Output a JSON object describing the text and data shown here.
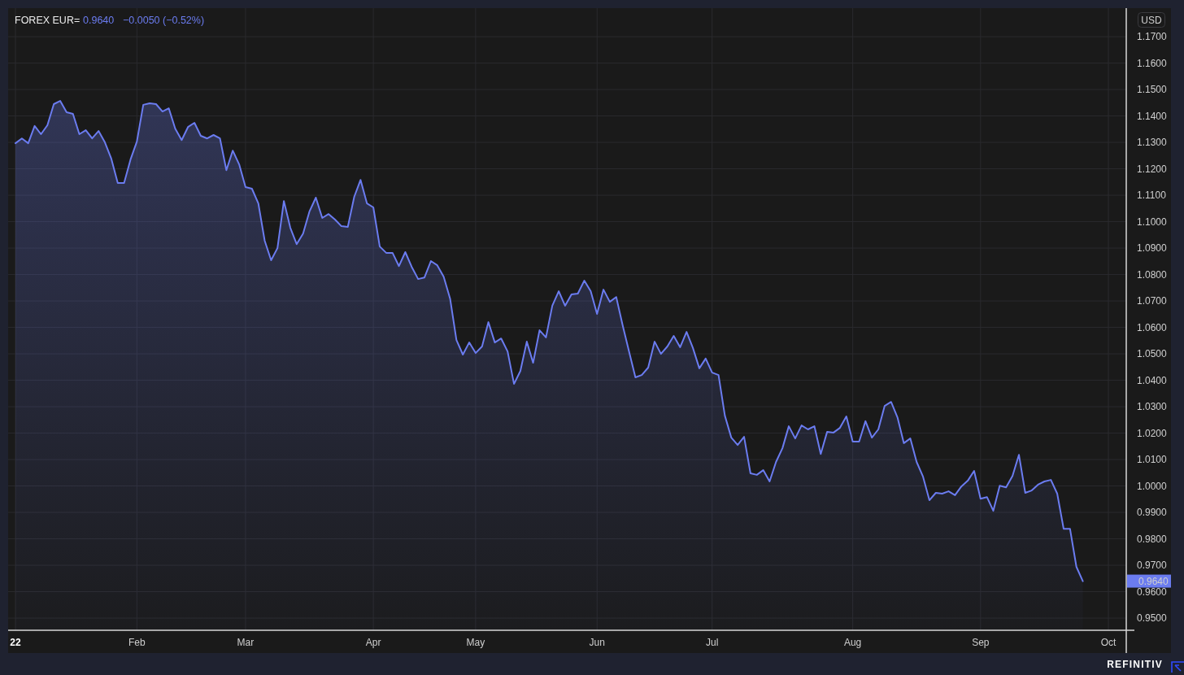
{
  "legend": {
    "last": "0.9640",
    "change": "−0.0050 (−0.52%)"
  },
  "currency": "USD",
  "price_badge": "0.9640",
  "chart_data": {
    "type": "area",
    "grid": true,
    "ylim": [
      0.9454,
      1.1808
    ],
    "categories": [
      "22",
      null,
      null,
      null,
      null,
      null,
      null,
      null,
      null,
      null,
      null,
      null,
      null,
      null,
      null,
      null,
      null,
      null,
      null,
      "Feb",
      null,
      null,
      null,
      null,
      null,
      null,
      null,
      null,
      null,
      null,
      null,
      null,
      null,
      null,
      null,
      null,
      "Mar",
      null,
      null,
      null,
      null,
      null,
      null,
      null,
      null,
      null,
      null,
      null,
      null,
      null,
      null,
      null,
      null,
      null,
      null,
      null,
      "Apr",
      null,
      null,
      null,
      null,
      null,
      null,
      null,
      null,
      null,
      null,
      null,
      null,
      null,
      null,
      null,
      "May",
      null,
      null,
      null,
      null,
      null,
      null,
      null,
      null,
      null,
      null,
      null,
      null,
      null,
      null,
      null,
      null,
      null,
      null,
      "Jun",
      null,
      null,
      null,
      null,
      null,
      null,
      null,
      null,
      null,
      null,
      null,
      null,
      null,
      null,
      null,
      null,
      null,
      "Jul",
      null,
      null,
      null,
      null,
      null,
      null,
      null,
      null,
      null,
      null,
      null,
      null,
      null,
      null,
      null,
      null,
      null,
      null,
      null,
      null,
      null,
      "Aug",
      null,
      null,
      null,
      null,
      null,
      null,
      null,
      null,
      null,
      null,
      null,
      null,
      null,
      null,
      null,
      null,
      null,
      null,
      null,
      "Sep",
      null,
      null,
      null,
      null,
      null,
      null,
      null,
      null,
      null,
      null,
      null,
      null,
      null,
      null,
      null,
      null,
      null,
      null,
      null,
      "Oct"
    ],
    "yticks": [
      {
        "value": 1.17,
        "label": "1.1700"
      },
      {
        "value": 1.16,
        "label": "1.1600"
      },
      {
        "value": 1.15,
        "label": "1.1500"
      },
      {
        "value": 1.14,
        "label": "1.1400"
      },
      {
        "value": 1.13,
        "label": "1.1300"
      },
      {
        "value": 1.12,
        "label": "1.1200"
      },
      {
        "value": 1.11,
        "label": "1.1100"
      },
      {
        "value": 1.1,
        "label": "1.1000"
      },
      {
        "value": 1.09,
        "label": "1.0900"
      },
      {
        "value": 1.08,
        "label": "1.0800"
      },
      {
        "value": 1.07,
        "label": "1.0700"
      },
      {
        "value": 1.06,
        "label": "1.0600"
      },
      {
        "value": 1.05,
        "label": "1.0500"
      },
      {
        "value": 1.04,
        "label": "1.0400"
      },
      {
        "value": 1.03,
        "label": "1.0300"
      },
      {
        "value": 1.02,
        "label": "1.0200"
      },
      {
        "value": 1.01,
        "label": "1.0100"
      },
      {
        "value": 1.0,
        "label": "1.0000"
      },
      {
        "value": 0.99,
        "label": "0.9900"
      },
      {
        "value": 0.98,
        "label": "0.9800"
      },
      {
        "value": 0.97,
        "label": "0.9700"
      },
      {
        "value": 0.96,
        "label": "0.9600"
      },
      {
        "value": 0.95,
        "label": "0.9500"
      }
    ],
    "series": [
      {
        "name": "FOREX EUR=",
        "color": "#6b7cf0",
        "values": [
          1.1297,
          1.1315,
          1.1297,
          1.1362,
          1.1331,
          1.1365,
          1.1445,
          1.1457,
          1.1414,
          1.1408,
          1.1331,
          1.1346,
          1.1315,
          1.1343,
          1.13,
          1.1238,
          1.1146,
          1.1146,
          1.1235,
          1.1303,
          1.1442,
          1.1448,
          1.1445,
          1.1417,
          1.1429,
          1.1352,
          1.1309,
          1.1358,
          1.1374,
          1.1325,
          1.1315,
          1.1328,
          1.1315,
          1.1195,
          1.1269,
          1.1217,
          1.1131,
          1.1125,
          1.1069,
          1.0928,
          1.0854,
          1.09,
          1.1078,
          1.0977,
          1.0915,
          1.0955,
          1.1038,
          1.1091,
          1.1014,
          1.1029,
          1.1008,
          1.0983,
          1.098,
          1.1094,
          1.1158,
          1.1069,
          1.1054,
          1.0906,
          1.0882,
          1.0882,
          1.0832,
          1.0885,
          1.0829,
          1.0783,
          1.0789,
          1.0851,
          1.0835,
          1.0792,
          1.0709,
          1.0552,
          1.0497,
          1.0543,
          1.0503,
          1.0528,
          1.062,
          1.0543,
          1.0558,
          1.0509,
          1.0386,
          1.0435,
          1.0546,
          1.0466,
          1.0589,
          1.0562,
          1.0682,
          1.0737,
          1.0682,
          1.0725,
          1.0728,
          1.0777,
          1.0737,
          1.0651,
          1.0743,
          1.0697,
          1.0715,
          1.0608,
          1.0509,
          1.0411,
          1.042,
          1.0448,
          1.0546,
          1.05,
          1.0528,
          1.0568,
          1.0525,
          1.0583,
          1.0522,
          1.0445,
          1.0482,
          1.0429,
          1.042,
          1.0266,
          1.0183,
          1.0155,
          1.0186,
          1.0048,
          1.0042,
          1.006,
          1.0017,
          1.0091,
          1.0143,
          1.0226,
          1.018,
          1.0229,
          1.0214,
          1.0226,
          1.0121,
          1.0205,
          1.0202,
          1.022,
          1.0263,
          1.0168,
          1.0168,
          1.0245,
          1.0183,
          1.0214,
          1.0303,
          1.0318,
          1.026,
          1.0162,
          1.018,
          1.0091,
          1.0035,
          0.9946,
          0.9974,
          0.9971,
          0.998,
          0.9965,
          0.9998,
          1.002,
          1.0057,
          0.9952,
          0.9958,
          0.9906,
          1.0001,
          0.9995,
          1.0038,
          1.0118,
          0.9974,
          0.9983,
          1.0005,
          1.0017,
          1.0023,
          0.9971,
          0.9838,
          0.9838,
          0.9694,
          0.964,
          null,
          null,
          null,
          null
        ]
      }
    ]
  },
  "brand": "REFINITIV"
}
